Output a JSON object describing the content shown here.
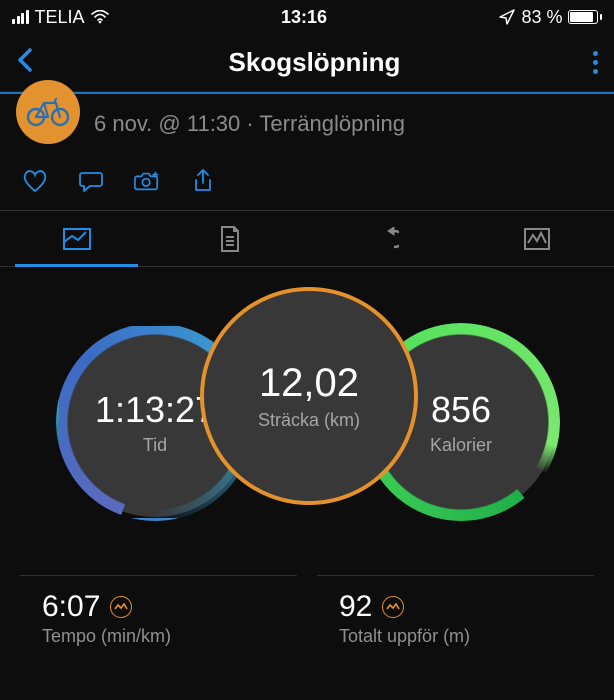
{
  "status": {
    "carrier": "TELIA",
    "time": "13:16",
    "battery_text": "83 %"
  },
  "nav": {
    "title": "Skogslöpning"
  },
  "activity": {
    "meta": "6 nov. @ 11:30 · Terränglöpning"
  },
  "circles": {
    "left": {
      "value": "1:13:27",
      "label": "Tid"
    },
    "center": {
      "value": "12,02",
      "label": "Sträcka (km)"
    },
    "right": {
      "value": "856",
      "label": "Kalorier"
    }
  },
  "stats": {
    "pace": {
      "value": "6:07",
      "label": "Tempo (min/km)"
    },
    "ascent": {
      "value": "92",
      "label": "Totalt uppför (m)"
    }
  }
}
